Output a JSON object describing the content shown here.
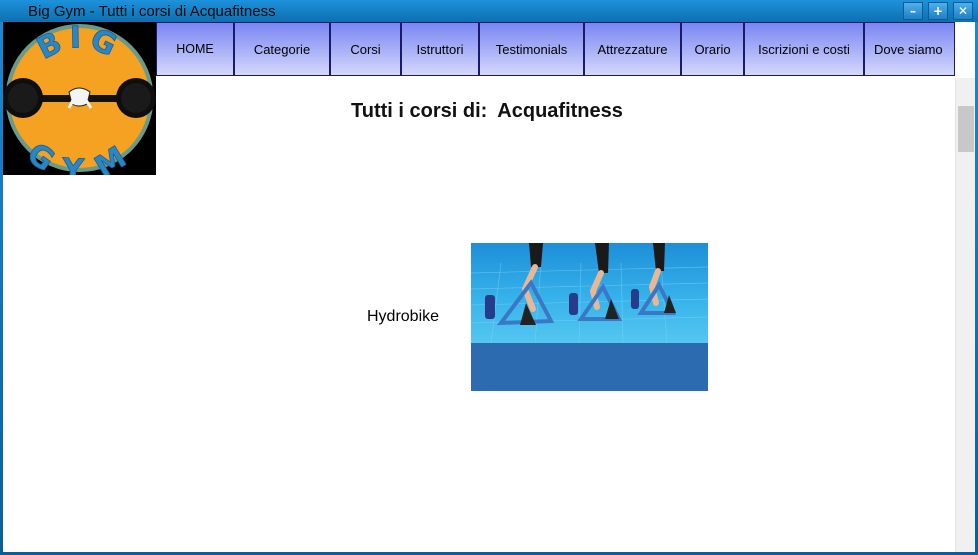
{
  "window": {
    "title": "Big Gym - Tutti i corsi di Acquafitness",
    "buttons": {
      "minimize": "–",
      "maximize": "+",
      "close": "✕"
    }
  },
  "logo": {
    "alt": "BIG GYM logo",
    "text_top": "BIG",
    "text_bottom": "GYM"
  },
  "nav": {
    "items": [
      {
        "label": "HOME"
      },
      {
        "label": "Categorie"
      },
      {
        "label": "Corsi"
      },
      {
        "label": "Istruttori"
      },
      {
        "label": "Testimonials"
      },
      {
        "label": "Attrezzature"
      },
      {
        "label": "Orario"
      },
      {
        "label": "Iscrizioni e costi"
      },
      {
        "label": "Dove siamo"
      }
    ]
  },
  "page": {
    "heading_prefix": "Tutti i corsi di:",
    "heading_category": "Acquafitness"
  },
  "courses": [
    {
      "name": "Hydrobike",
      "image": "hydrobike-photo"
    }
  ],
  "colors": {
    "nav_top": "#7a86f2",
    "nav_bottom": "#d4d8fb",
    "titlebar": "#1d92dc",
    "logo_orange": "#f5a122",
    "logo_blue": "#2b86c4"
  }
}
